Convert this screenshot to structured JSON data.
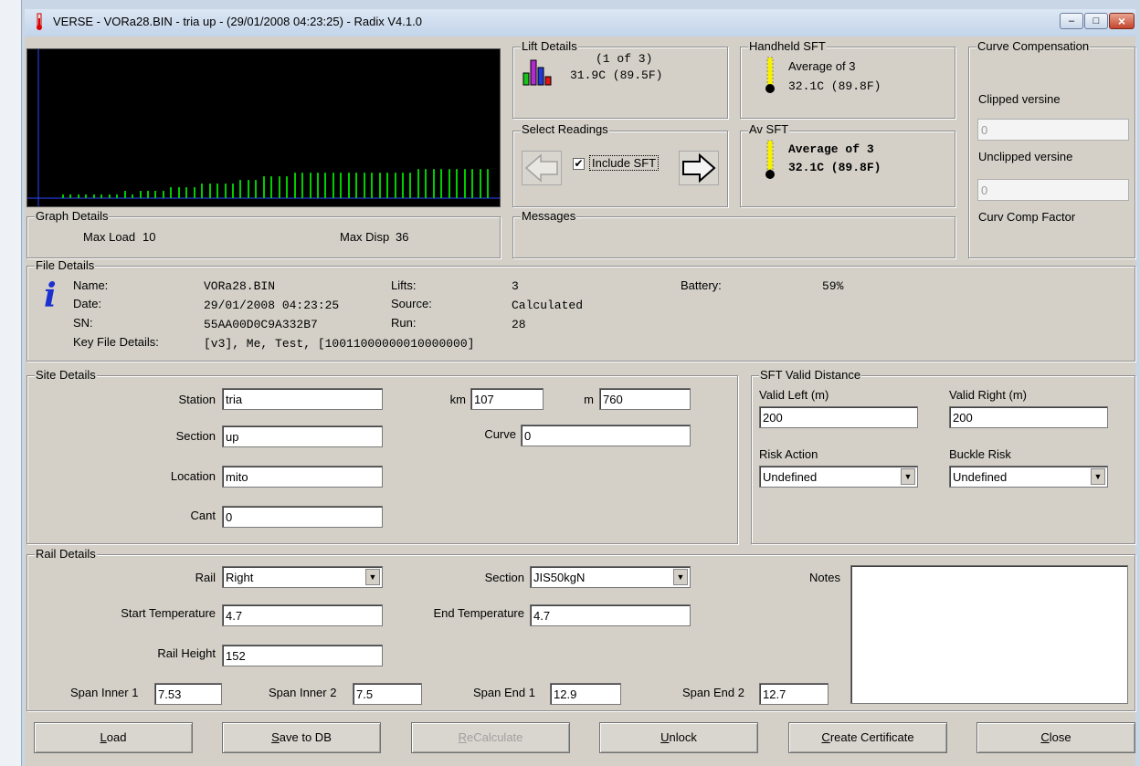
{
  "window": {
    "title": "VERSE - VORa28.BIN - tria up - (29/01/2008 04:23:25) - Radix V4.1.0",
    "controls": {
      "minimize": "–",
      "maximize": "□",
      "close": "×"
    }
  },
  "graph": {
    "bars": [
      1,
      1,
      1,
      1,
      1,
      1,
      1,
      1,
      2,
      1,
      2,
      2,
      2,
      2,
      3,
      3,
      3,
      3,
      4,
      4,
      4,
      4,
      4,
      5,
      5,
      5,
      6,
      6,
      6,
      6,
      7,
      7,
      7,
      7,
      7,
      7,
      7,
      7,
      7,
      7,
      7,
      7,
      7,
      7,
      7,
      7,
      8,
      8,
      8,
      8,
      8,
      8,
      8,
      8,
      8,
      8
    ],
    "bar_color": "#00cc00",
    "axis_color": "#2b46ff"
  },
  "graph_details": {
    "label": "Graph Details",
    "max_load_label": "Max Load",
    "max_load": "10",
    "max_disp_label": "Max Disp",
    "max_disp": "36"
  },
  "lift_details": {
    "label": "Lift Details",
    "index": "(1 of 3)",
    "reading": "31.9C (89.5F)"
  },
  "select_readings": {
    "label": "Select Readings",
    "include_sft_label": "Include SFT",
    "include_sft_checked": true
  },
  "handheld_sft": {
    "label": "Handheld SFT",
    "average_label": "Average of 3",
    "reading": "32.1C (89.8F)"
  },
  "av_sft": {
    "label": "Av SFT",
    "average_label": "Average of 3",
    "reading": "32.1C (89.8F)"
  },
  "curve_compensation": {
    "label": "Curve Compensation",
    "clipped_label": "Clipped versine",
    "clipped_value": "0",
    "unclipped_label": "Unclipped versine",
    "unclipped_value": "0",
    "factor_label": "Curv Comp Factor"
  },
  "messages": {
    "label": "Messages"
  },
  "file_details": {
    "label": "File Details",
    "name_label": "Name:",
    "name": "VORa28.BIN",
    "date_label": "Date:",
    "date": "29/01/2008 04:23:25",
    "sn_label": "SN:",
    "sn": "55AA00D0C9A332B7",
    "key_label": "Key File Details:",
    "key": "[v3], Me, Test, [10011000000010000000]",
    "lifts_label": "Lifts:",
    "lifts": "3",
    "source_label": "Source:",
    "source": "Calculated",
    "run_label": "Run:",
    "run": "28",
    "battery_label": "Battery:",
    "battery": "59%"
  },
  "site_details": {
    "label": "Site Details",
    "station_label": "Station",
    "station": "tria",
    "section_label": "Section",
    "section": "up",
    "location_label": "Location",
    "location": "mito",
    "cant_label": "Cant",
    "cant": "0",
    "km_label": "km",
    "km": "107",
    "m_label": "m",
    "m": "760",
    "curve_label": "Curve",
    "curve": "0"
  },
  "sft_valid": {
    "label": "SFT Valid Distance",
    "left_label": "Valid Left (m)",
    "left": "200",
    "right_label": "Valid Right (m)",
    "right": "200",
    "risk_action_label": "Risk Action",
    "risk_action": "Undefined",
    "buckle_risk_label": "Buckle Risk",
    "buckle_risk": "Undefined"
  },
  "rail_details": {
    "label": "Rail Details",
    "rail_label": "Rail",
    "rail": "Right",
    "section_label": "Section",
    "section": "JIS50kgN",
    "start_temp_label": "Start Temperature",
    "start_temp": "4.7",
    "end_temp_label": "End Temperature",
    "end_temp": "4.7",
    "rail_height_label": "Rail Height",
    "rail_height": "152",
    "span_inner1_label": "Span Inner 1",
    "span_inner1": "7.53",
    "span_inner2_label": "Span Inner 2",
    "span_inner2": "7.5",
    "span_end1_label": "Span End 1",
    "span_end1": "12.9",
    "span_end2_label": "Span End 2",
    "span_end2": "12.7",
    "notes_label": "Notes",
    "notes": ""
  },
  "buttons": {
    "load": {
      "accel": "L",
      "rest": "oad"
    },
    "save": {
      "accel": "S",
      "rest": "ave to DB"
    },
    "recalc": {
      "accel": "R",
      "rest": "eCalculate"
    },
    "unlock": {
      "accel": "U",
      "rest": "nlock"
    },
    "certificate": {
      "accel": "C",
      "rest": "reate Certificate"
    },
    "close": {
      "accel": "C",
      "rest": "lose"
    }
  }
}
